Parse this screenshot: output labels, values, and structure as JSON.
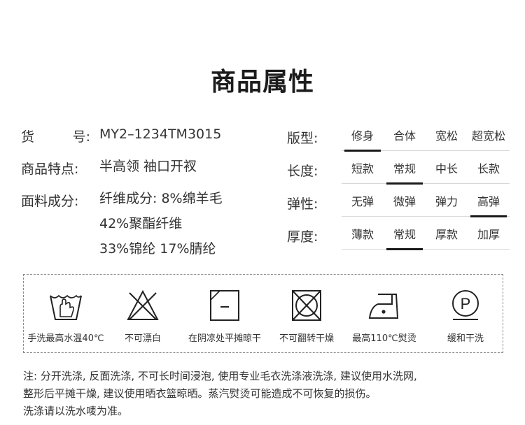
{
  "title": "商品属性",
  "info": {
    "sku_label_a": "货",
    "sku_label_b": "号:",
    "sku_value": "MY2–1234TM3015",
    "feature_label": "商品特点:",
    "feature_value": "半高领 袖口开衩",
    "material_label": "面料成分:",
    "material_lines": [
      "纤维成分: 8%绵羊毛",
      "42%聚酯纤维",
      "33%锦纶 17%腈纶"
    ]
  },
  "attributes": [
    {
      "label": "版型:",
      "options": [
        "修身",
        "合体",
        "宽松",
        "超宽松"
      ],
      "selected": 0
    },
    {
      "label": "长度:",
      "options": [
        "短款",
        "常规",
        "中长",
        "长款"
      ],
      "selected": 1
    },
    {
      "label": "弹性:",
      "options": [
        "无弹",
        "微弹",
        "弹力",
        "高弹"
      ],
      "selected": 3
    },
    {
      "label": "厚度:",
      "options": [
        "薄款",
        "常规",
        "厚款",
        "加厚"
      ],
      "selected": 1
    }
  ],
  "care": [
    {
      "icon": "hand-wash-icon",
      "label": "手洗最高水温40℃"
    },
    {
      "icon": "no-bleach-icon",
      "label": "不可漂白"
    },
    {
      "icon": "flat-dry-shade-icon",
      "label": "在阴凉处平摊晾干"
    },
    {
      "icon": "no-tumble-dry-icon",
      "label": "不可翻转干燥"
    },
    {
      "icon": "iron-110-icon",
      "label": "最高110℃熨烫"
    },
    {
      "icon": "gentle-dry-clean-icon",
      "label": "缓和干洗"
    }
  ],
  "notes": [
    "注: 分开洗涤, 反面洗涤, 不可长时间浸泡, 使用专业毛衣洗涤液洗涤, 建议使用水洗网,",
    "整形后平摊干燥, 建议使用晒衣篮晾晒。蒸汽熨烫可能造成不可恢复的损伤。",
    "洗涤请以洗水唛为准。"
  ]
}
